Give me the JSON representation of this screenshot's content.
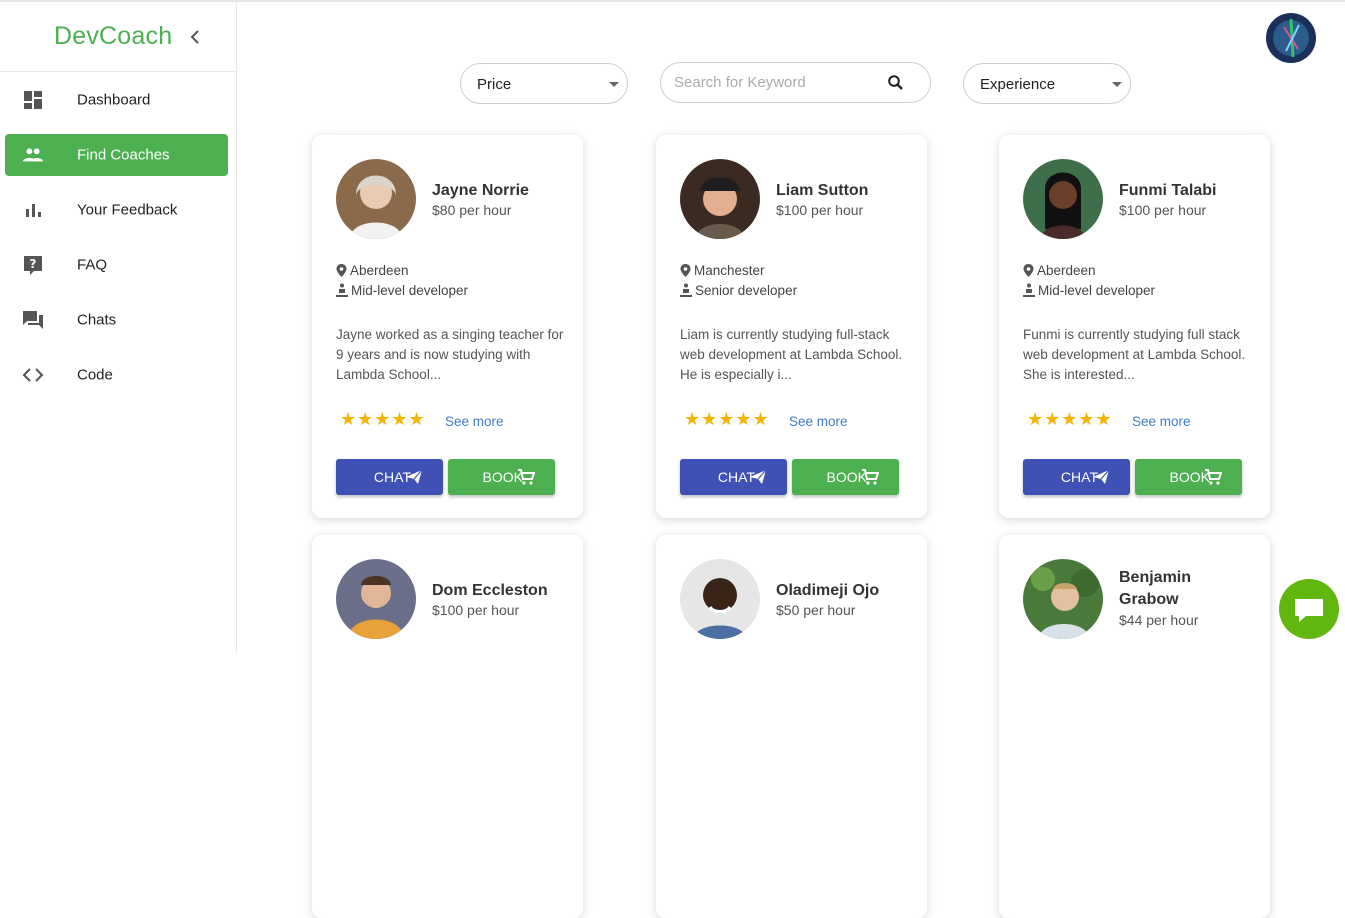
{
  "brand": "DevCoach",
  "nav": [
    {
      "label": "Dashboard",
      "icon": "dashboard-icon"
    },
    {
      "label": "Find Coaches",
      "icon": "people-icon",
      "active": true
    },
    {
      "label": "Your Feedback",
      "icon": "bar-chart-icon"
    },
    {
      "label": "FAQ",
      "icon": "question-icon"
    },
    {
      "label": "Chats",
      "icon": "chat-bubbles-icon"
    },
    {
      "label": "Code",
      "icon": "code-icon"
    }
  ],
  "filters": {
    "price": "Price",
    "search_placeholder": "Search for Keyword",
    "experience": "Experience"
  },
  "coaches": [
    {
      "name": "Jayne Norrie",
      "price": "$80 per hour",
      "location": "Aberdeen",
      "level": "Mid-level developer",
      "bio": "Jayne worked as a singing teacher for 9 years and is now studying with Lambda School...",
      "stars": "★★★★★",
      "see_more": "See more",
      "chat": "CHAT",
      "book": "BOOK"
    },
    {
      "name": "Liam Sutton",
      "price": "$100 per hour",
      "location": "Manchester",
      "level": "Senior developer",
      "bio": "Liam is currently studying full-stack web development at Lambda School. He is especially i...",
      "stars": "★★★★★",
      "see_more": "See more",
      "chat": "CHAT",
      "book": "BOOK"
    },
    {
      "name": "Funmi Talabi",
      "price": "$100 per hour",
      "location": "Aberdeen",
      "level": "Mid-level developer",
      "bio": "Funmi is currently studying full stack web development at Lambda School. She is interested...",
      "stars": "★★★★★",
      "see_more": "See more",
      "chat": "CHAT",
      "book": "BOOK"
    },
    {
      "name": "Dom Eccleston",
      "price": "$100 per hour"
    },
    {
      "name": "Oladimeji Ojo",
      "price": "$50 per hour"
    },
    {
      "name": "Benjamin Grabow",
      "price": "$44 per hour"
    }
  ],
  "colors": {
    "brand_green": "#4caf50",
    "chat_button": "#3f51b5",
    "book_button": "#4caf50",
    "stars": "#f5b400",
    "link": "#3f7cc4",
    "chat_fab": "#62b70f"
  }
}
